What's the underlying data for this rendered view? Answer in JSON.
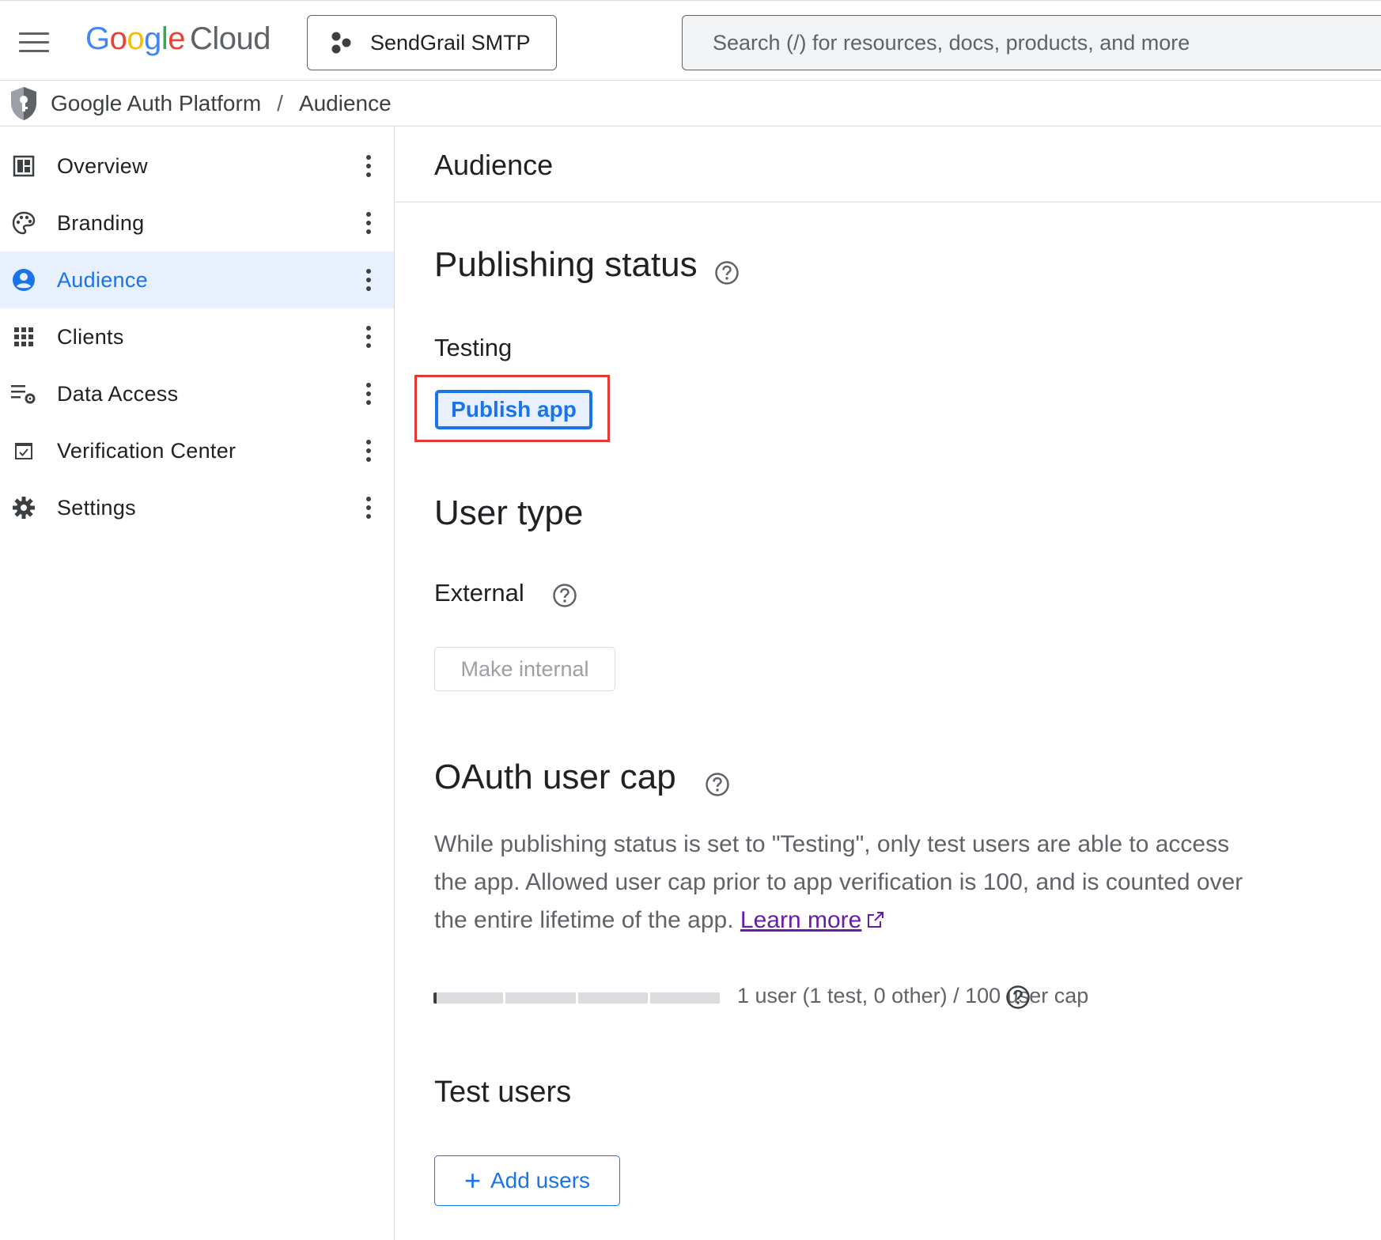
{
  "header": {
    "logo_google": "Google",
    "logo_cloud": "Cloud",
    "project_name": "SendGrail SMTP",
    "search_placeholder": "Search (/) for resources, docs, products, and more"
  },
  "breadcrumb": {
    "product": "Google Auth Platform",
    "separator": "/",
    "current": "Audience"
  },
  "sidebar": {
    "items": [
      {
        "label": "Overview",
        "icon": "dashboard-icon"
      },
      {
        "label": "Branding",
        "icon": "palette-icon"
      },
      {
        "label": "Audience",
        "icon": "account-circle-icon",
        "active": true
      },
      {
        "label": "Clients",
        "icon": "apps-grid-icon"
      },
      {
        "label": "Data Access",
        "icon": "list-settings-icon"
      },
      {
        "label": "Verification Center",
        "icon": "checkbox-icon"
      },
      {
        "label": "Settings",
        "icon": "gear-icon"
      }
    ]
  },
  "page": {
    "title": "Audience",
    "publishing": {
      "title": "Publishing status",
      "status": "Testing",
      "publish_button": "Publish app"
    },
    "user_type": {
      "title": "User type",
      "value": "External",
      "make_internal_button": "Make internal"
    },
    "oauth_cap": {
      "title": "OAuth user cap",
      "description": "While publishing status is set to \"Testing\", only test users are able to access the app. Allowed user cap prior to app verification is 100, and is counted over the entire lifetime of the app.",
      "learn_more": "Learn more",
      "usage_text": "1 user (1 test, 0 other) / 100 user cap",
      "users": 1,
      "cap": 100
    },
    "test_users": {
      "title": "Test users",
      "add_button": "Add users"
    }
  },
  "colors": {
    "accent": "#1a73e8",
    "highlight_border": "#e53935",
    "active_nav_bg": "#e8f0fe",
    "link_visited": "#681da8"
  }
}
